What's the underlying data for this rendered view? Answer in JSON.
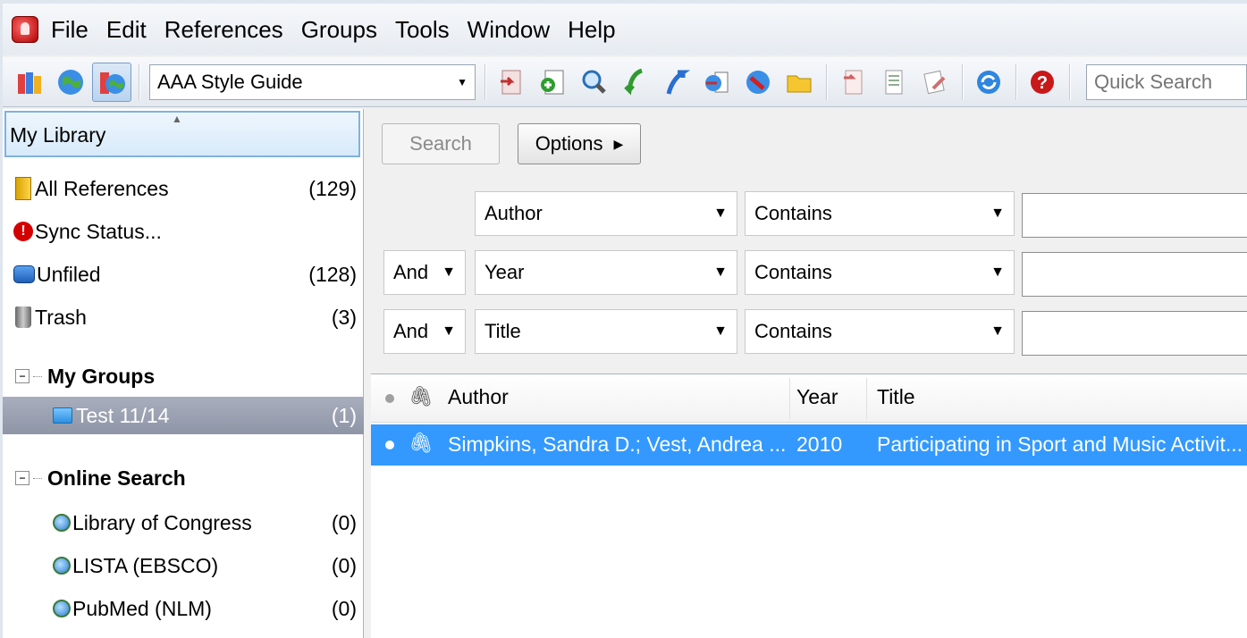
{
  "menu": [
    "File",
    "Edit",
    "References",
    "Groups",
    "Tools",
    "Window",
    "Help"
  ],
  "toolbar": {
    "style_value": "AAA Style Guide",
    "quick_search_placeholder": "Quick Search"
  },
  "library": {
    "header": "My Library",
    "items": [
      {
        "label": "All References",
        "count": "(129)"
      },
      {
        "label": "Sync Status...",
        "count": ""
      },
      {
        "label": "Unfiled",
        "count": "(128)"
      },
      {
        "label": "Trash",
        "count": "(3)"
      }
    ],
    "my_groups": {
      "label": "My Groups",
      "items": [
        {
          "label": "Test 11/14",
          "count": "(1)"
        }
      ]
    },
    "online_search": {
      "label": "Online Search",
      "items": [
        {
          "label": "Library of Congress",
          "count": "(0)"
        },
        {
          "label": "LISTA (EBSCO)",
          "count": "(0)"
        },
        {
          "label": "PubMed (NLM)",
          "count": "(0)"
        }
      ]
    }
  },
  "search": {
    "search_button": "Search",
    "options_button": "Options",
    "rows": [
      {
        "bool": "",
        "field": "Author",
        "op": "Contains",
        "value": ""
      },
      {
        "bool": "And",
        "field": "Year",
        "op": "Contains",
        "value": ""
      },
      {
        "bool": "And",
        "field": "Title",
        "op": "Contains",
        "value": ""
      }
    ]
  },
  "results": {
    "columns": [
      "Author",
      "Year",
      "Title"
    ],
    "rows": [
      {
        "author": "Simpkins, Sandra D.; Vest, Andrea ...",
        "year": "2010",
        "title": "Participating in Sport and Music Activit..."
      }
    ]
  },
  "colors": {
    "selection": "#3399ff",
    "group_selection": "#9aa1b1"
  }
}
